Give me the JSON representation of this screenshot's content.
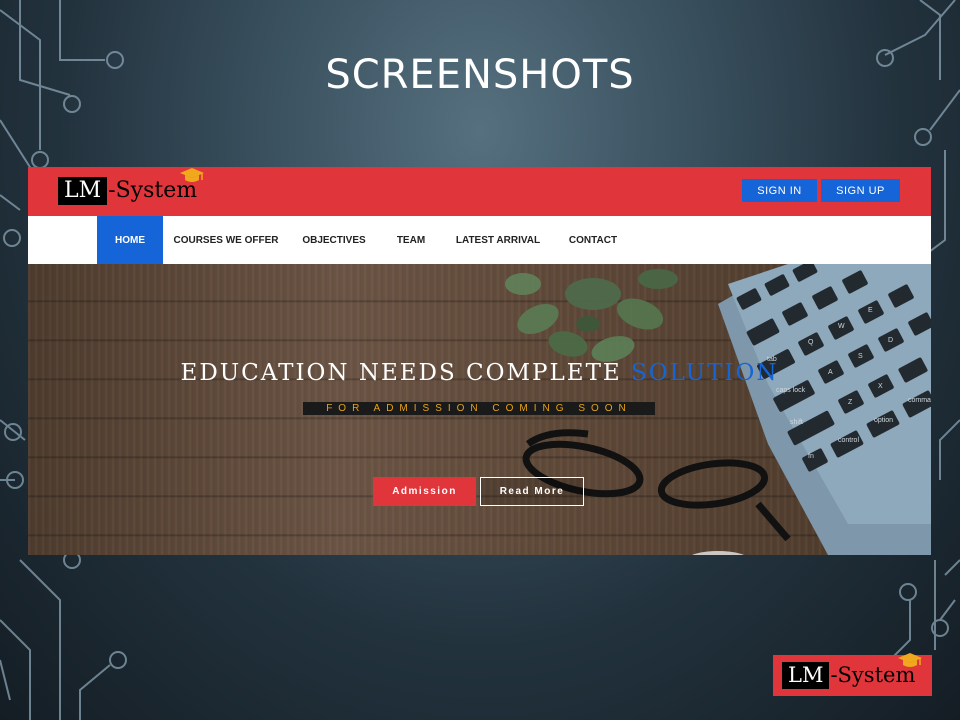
{
  "slide": {
    "title": "SCREENSHOTS"
  },
  "site": {
    "logo": {
      "box_text": "LM",
      "text": "-System"
    },
    "auth": {
      "sign_in": "SIGN IN",
      "sign_up": "SIGN UP"
    },
    "nav": {
      "items": [
        {
          "label": "HOME",
          "active": true
        },
        {
          "label": "COURSES WE OFFER",
          "active": false
        },
        {
          "label": "OBJECTIVES",
          "active": false
        },
        {
          "label": "TEAM",
          "active": false
        },
        {
          "label": "LATEST ARRIVAL",
          "active": false
        },
        {
          "label": "CONTACT",
          "active": false
        }
      ]
    },
    "hero": {
      "headline_main": "EDUCATION NEEDS COMPLETE ",
      "headline_accent": "SOLUTION",
      "subline": "FOR ADMISSION COMING SOON",
      "primary_button": "Admission",
      "secondary_button": "Read More",
      "keyboard_keys": [
        "tab",
        "caps lock",
        "shift",
        "fn",
        "control",
        "option",
        "command",
        "Q",
        "W",
        "E",
        "A",
        "S",
        "D",
        "Z",
        "X"
      ]
    }
  },
  "corner_logo": {
    "box_text": "LM",
    "text": "-System"
  },
  "colors": {
    "brand_red": "#e0353b",
    "brand_blue": "#1565d8",
    "subline_text": "#e8a317"
  }
}
